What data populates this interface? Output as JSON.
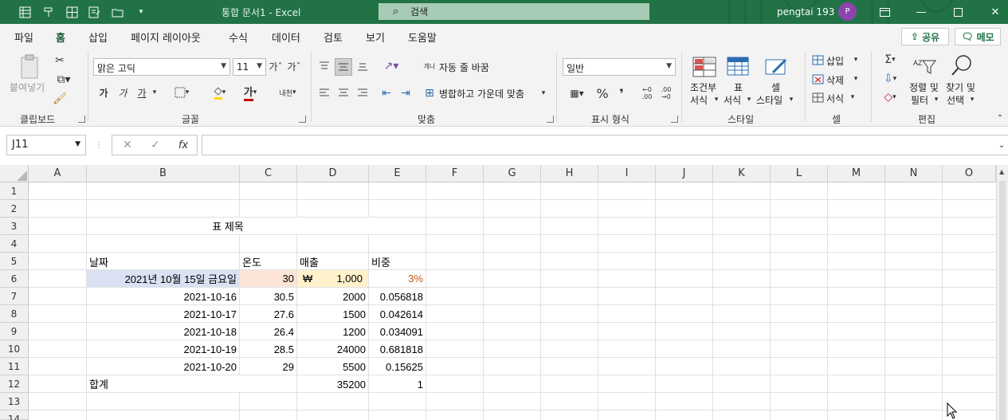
{
  "title_bar": {
    "document_title": "통합 문서1  -  Excel",
    "search_placeholder": "검색",
    "user_name": "pengtai 193",
    "avatar_initial": "P",
    "accent": "#217346"
  },
  "quick_access": [
    "table-icon",
    "format-painter-icon",
    "grid-icon",
    "form-icon",
    "folder-icon",
    "customize-icon"
  ],
  "ribbon_tabs": [
    "파일",
    "홈",
    "삽입",
    "페이지 레이아웃",
    "수식",
    "데이터",
    "검토",
    "보기",
    "도움말"
  ],
  "active_tab": "홈",
  "share_label": "공유",
  "memo_label": "메모",
  "clipboard": {
    "paste": "붙여넣기",
    "label": "클립보드"
  },
  "font": {
    "name": "맑은 고딕",
    "size": "11",
    "bold": "가",
    "italic": "가",
    "underline": "가",
    "color_sample": "가",
    "phonetic": "내천",
    "label": "글꼴"
  },
  "alignment": {
    "wrap": "자동 줄 바꿈",
    "merge": "병합하고 가운데 맞춤",
    "label": "맞춤",
    "wrap_icon": "개나"
  },
  "number": {
    "format": "일반",
    "percent": "%",
    "comma": "❜",
    "inc": "←0 .00",
    "dec": ".00 →0",
    "label": "표시 형식"
  },
  "styles": {
    "conditional": [
      "조건부",
      "서식"
    ],
    "table": [
      "표",
      "서식"
    ],
    "cell": [
      "셀",
      "스타일"
    ],
    "label": "스타일"
  },
  "cells_group": {
    "insert": "삽입",
    "delete": "삭제",
    "format": "서식",
    "label": "셀"
  },
  "editing": {
    "sort": [
      "정렬 및",
      "필터"
    ],
    "find": [
      "찾기 및",
      "선택"
    ],
    "label": "편집"
  },
  "formula_bar": {
    "name_box": "J11",
    "fx": "fx",
    "cancel": "✕",
    "enter": "✓",
    "content": ""
  },
  "columns": [
    "A",
    "B",
    "C",
    "D",
    "E",
    "F",
    "G",
    "H",
    "I",
    "J",
    "K",
    "L",
    "M",
    "N",
    "O"
  ],
  "rows": [
    "1",
    "2",
    "3",
    "4",
    "5",
    "6",
    "7",
    "8",
    "9",
    "10",
    "11",
    "12",
    "13",
    "14"
  ],
  "sheet": {
    "title": "표 제목",
    "headers": [
      "날짜",
      "온도",
      "매출",
      "비중"
    ],
    "row6": {
      "date": "2021년 10월 15일 금요일",
      "temp": "30",
      "currency": "₩",
      "sales": "1,000",
      "ratio": "3%"
    },
    "data_rows": [
      {
        "date": "2021-10-16",
        "temp": "30.5",
        "sales": "2000",
        "ratio": "0.056818"
      },
      {
        "date": "2021-10-17",
        "temp": "27.6",
        "sales": "1500",
        "ratio": "0.042614"
      },
      {
        "date": "2021-10-18",
        "temp": "26.4",
        "sales": "1200",
        "ratio": "0.034091"
      },
      {
        "date": "2021-10-19",
        "temp": "28.5",
        "sales": "24000",
        "ratio": "0.681818"
      },
      {
        "date": "2021-10-20",
        "temp": "29",
        "sales": "5500",
        "ratio": "0.15625"
      }
    ],
    "total": {
      "label": "합계",
      "sales": "35200",
      "ratio": "1"
    },
    "colors": {
      "date_fill": "#d9e1f2",
      "temp_fill": "#fce4d6",
      "sales_fill": "#fff2cc",
      "ratio_text": "#c65911"
    }
  }
}
